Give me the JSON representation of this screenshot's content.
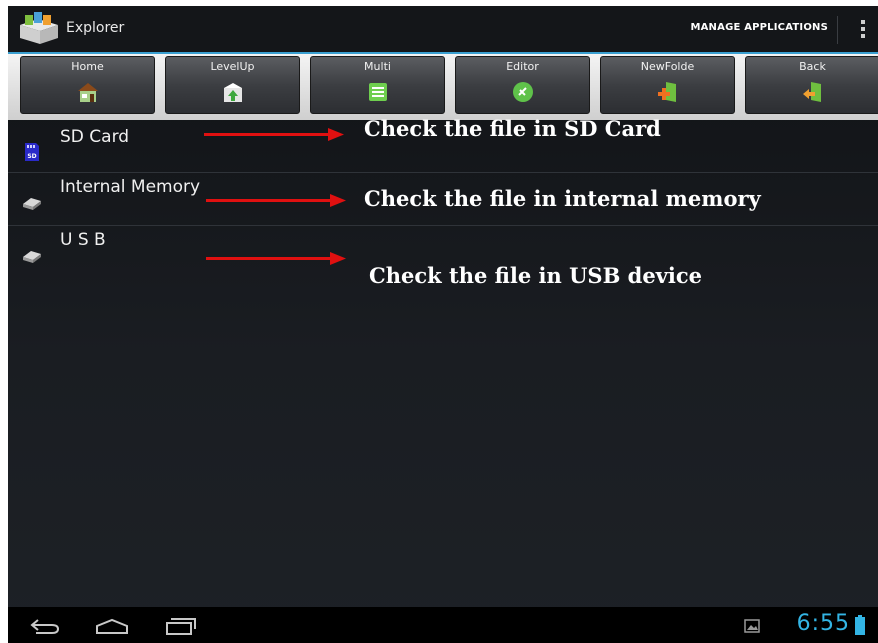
{
  "app": {
    "title": "Explorer"
  },
  "actionbar": {
    "manage_label": "MANAGE APPLICATIONS",
    "overflow_icon": "overflow-menu-icon"
  },
  "toolbar": {
    "buttons": [
      {
        "label": "Home",
        "icon": "home-icon"
      },
      {
        "label": "LevelUp",
        "icon": "level-up-icon"
      },
      {
        "label": "Multi",
        "icon": "multi-select-icon"
      },
      {
        "label": "Editor",
        "icon": "editor-icon"
      },
      {
        "label": "NewFolde",
        "icon": "new-folder-icon"
      },
      {
        "label": "Back",
        "icon": "back-icon"
      }
    ]
  },
  "storage": {
    "items": [
      {
        "name": "SD Card",
        "icon": "sd-card-icon"
      },
      {
        "name": "Internal Memory",
        "icon": "drive-icon"
      },
      {
        "name": "U S B",
        "icon": "drive-icon"
      }
    ]
  },
  "annotations": [
    "Check the file in SD Card",
    "Check the file in internal memory",
    "Check the file in USB device"
  ],
  "statusbar": {
    "time": "6:55"
  },
  "colors": {
    "accent": "#33b5e5",
    "arrow": "#e01010",
    "toolbar_bg": "#e2e2e2"
  }
}
